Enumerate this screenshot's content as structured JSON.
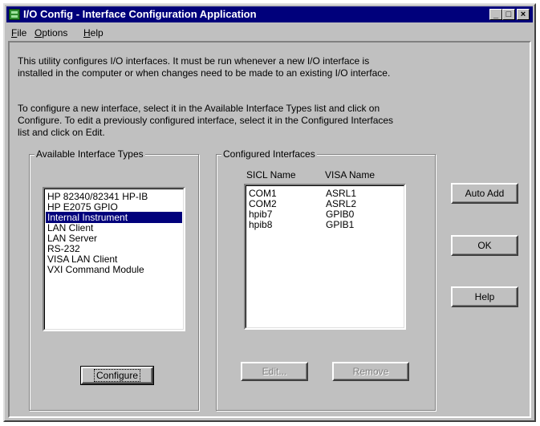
{
  "window": {
    "title": "I/O Config -  Interface Configuration Application",
    "controls": {
      "minimize": "_",
      "maximize": "□",
      "close": "×"
    }
  },
  "menu": {
    "file": "File",
    "options": "Options",
    "help": "Help"
  },
  "description": {
    "line1": "This utility configures I/O interfaces.  It must be run whenever a new I/O interface is",
    "line2": "installed in the computer or when changes need to be made to an existing I/O interface.",
    "line3": "To configure a new interface, select it in the Available Interface Types list and click on",
    "line4": "Configure.  To edit a previously configured interface, select it in the Configured Interfaces",
    "line5": "list and click on Edit."
  },
  "available": {
    "label": "Available Interface Types",
    "items": [
      "HP 82340/82341 HP-IB",
      "HP E2075 GPIO",
      "Internal Instrument",
      "LAN Client",
      "LAN Server",
      "RS-232",
      "VISA LAN Client",
      "VXI Command Module"
    ],
    "selected_index": 2,
    "configure_label": "Configure"
  },
  "configured": {
    "label": "Configured Interfaces",
    "sicl_header": "SICL Name",
    "visa_header": "VISA Name",
    "rows": [
      {
        "sicl": "COM1",
        "visa": "ASRL1"
      },
      {
        "sicl": "COM2",
        "visa": "ASRL2"
      },
      {
        "sicl": "hpib7",
        "visa": "GPIB0"
      },
      {
        "sicl": "hpib8",
        "visa": "GPIB1"
      }
    ],
    "edit_label": "Edit...",
    "remove_label": "Remove"
  },
  "side_buttons": {
    "auto_add": "Auto Add",
    "ok": "OK",
    "help": "Help"
  },
  "colors": {
    "titlebar": "#00007b",
    "face": "#c0c0c0",
    "selection": "#00007b"
  }
}
